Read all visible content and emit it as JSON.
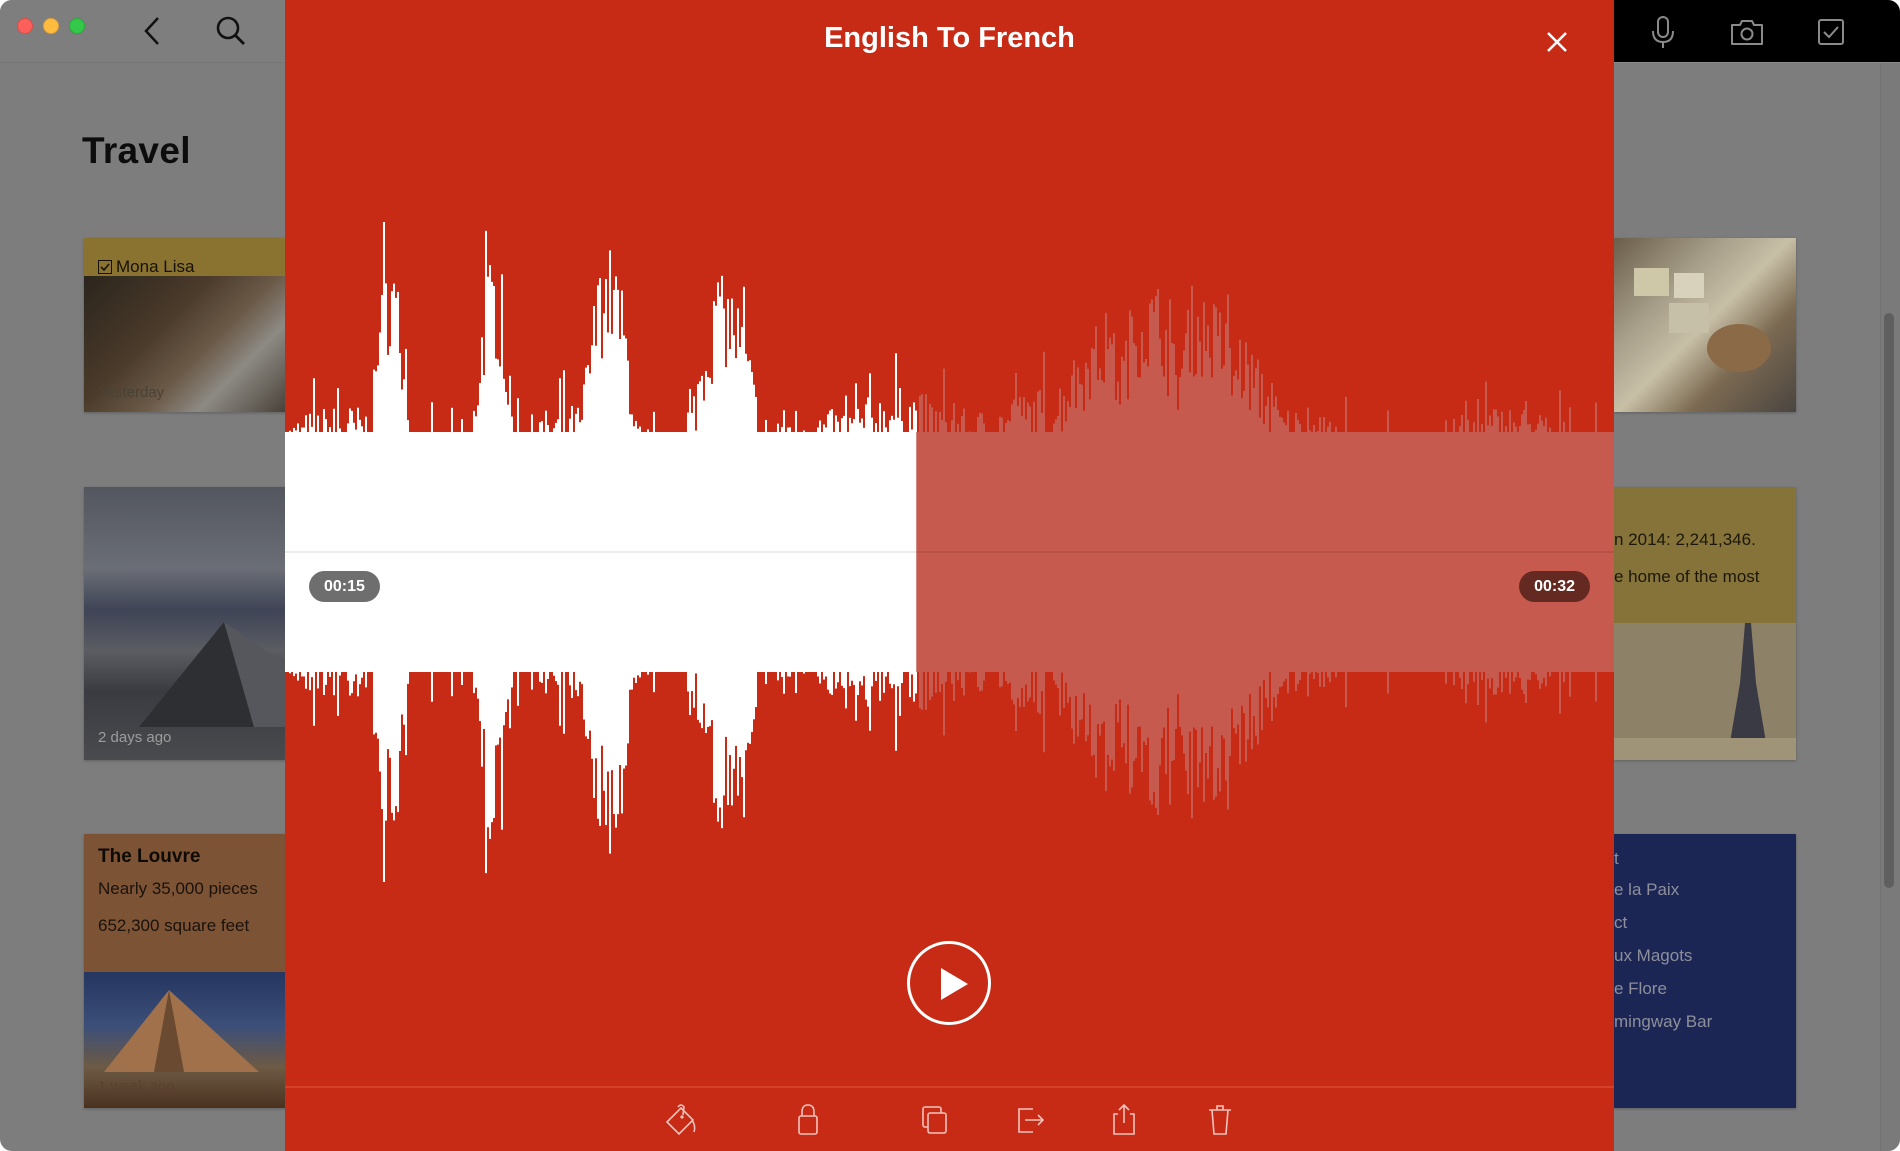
{
  "window": {
    "toolbar_left": {
      "buttons": [
        {
          "name": "close-window",
          "icon": "traffic-red"
        },
        {
          "name": "minimize-window",
          "icon": "traffic-yellow"
        },
        {
          "name": "zoom-window",
          "icon": "traffic-green"
        },
        {
          "name": "back",
          "icon": "chevron-left-icon"
        },
        {
          "name": "search",
          "icon": "search-icon"
        }
      ]
    },
    "toolbar_right": {
      "buttons": [
        {
          "name": "record-audio",
          "icon": "microphone-icon"
        },
        {
          "name": "add-photo",
          "icon": "camera-icon"
        },
        {
          "name": "add-checklist",
          "icon": "checkbox-icon"
        }
      ]
    }
  },
  "notebook": {
    "title": "Travel",
    "cards_left": [
      {
        "title": "Mona Lisa",
        "has_checkbox": true,
        "time": "Yesterday",
        "color": "#8a7331"
      },
      {
        "title": "",
        "time": "2 days ago",
        "color": "#4a4d55"
      },
      {
        "title": "The Louvre",
        "lines": [
          "Nearly 35,000 pieces",
          "652,300 square feet"
        ],
        "time": "1 week ago",
        "color": "#7d5336"
      }
    ],
    "cards_right": [
      {
        "title": "",
        "time": "",
        "color": "#6a6450"
      },
      {
        "lines": [
          "n 2014: 2,241,346.",
          "e home of the most"
        ],
        "color": "#85733a"
      },
      {
        "lines": [
          "t",
          "e la Paix",
          "ct",
          "ux Magots",
          "e Flore",
          "mingway Bar"
        ],
        "color": "#1c2655"
      }
    ]
  },
  "audio_player": {
    "title": "English To French",
    "elapsed": "00:15",
    "remaining": "00:32",
    "progress_fraction": 0.475,
    "colors": {
      "background": "#c72a15",
      "played": "#ffffff",
      "unplayed": "#c65a4f",
      "elapsed_badge": "#6e6e6e",
      "remaining_badge": "#642a22"
    },
    "toolbar": [
      {
        "name": "color",
        "icon": "paint-bucket-icon"
      },
      {
        "name": "lock",
        "icon": "lock-icon"
      },
      {
        "name": "duplicate",
        "icon": "duplicate-icon"
      },
      {
        "name": "move",
        "icon": "move-icon"
      },
      {
        "name": "share",
        "icon": "share-icon"
      },
      {
        "name": "delete",
        "icon": "trash-icon"
      }
    ]
  }
}
